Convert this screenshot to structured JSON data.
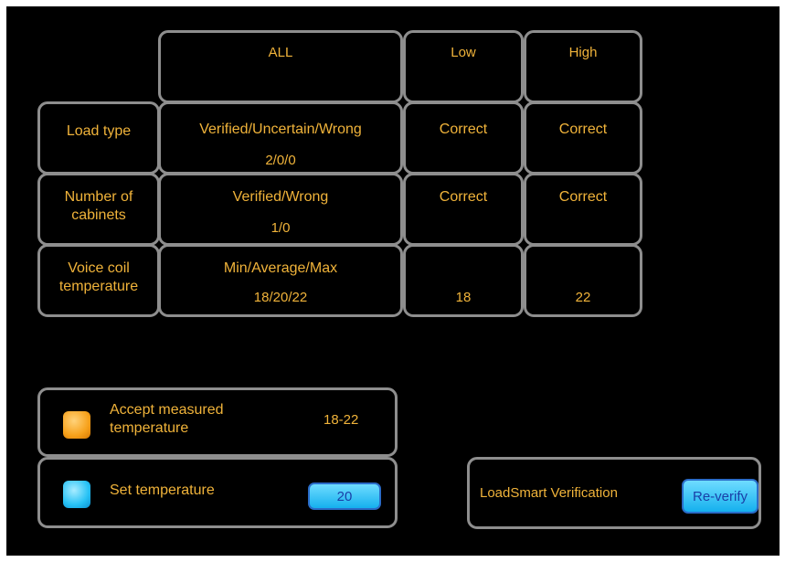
{
  "table": {
    "headers": {
      "all": "ALL",
      "low": "Low",
      "high": "High"
    },
    "rows": [
      {
        "label_line1": "Load type",
        "label_line2": "",
        "all_line1": "Verified/Uncertain/Wrong",
        "all_line2": "2/0/0",
        "low": "Correct",
        "high": "Correct"
      },
      {
        "label_line1": "Number of",
        "label_line2": "cabinets",
        "all_line1": "Verified/Wrong",
        "all_line2": "1/0",
        "low": "Correct",
        "high": "Correct"
      },
      {
        "label_line1": "Voice coil",
        "label_line2": "temperature",
        "all_line1": "Min/Average/Max",
        "all_line2": "18/20/22",
        "low": "18",
        "high": "22"
      }
    ]
  },
  "accept": {
    "label_line1": "Accept measured",
    "label_line2": "temperature",
    "value": "18-22"
  },
  "set_temp": {
    "label": "Set temperature",
    "value": "20"
  },
  "verify": {
    "label": "LoadSmart Verification",
    "button": "Re-verify"
  },
  "colors": {
    "text": "#f0b33a",
    "border": "#8e8e8e",
    "button": "#27c2f5",
    "indicator": "#f7a21c"
  }
}
